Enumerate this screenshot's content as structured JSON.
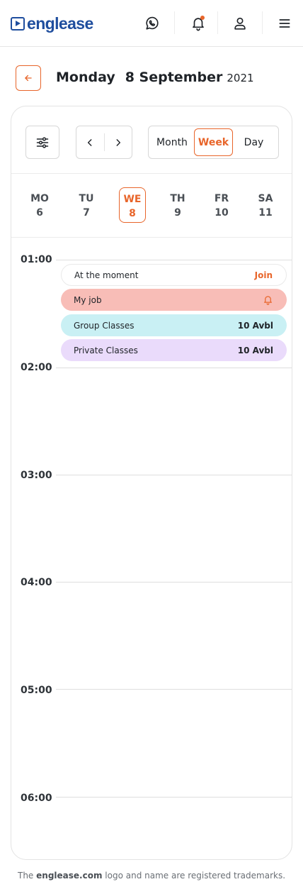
{
  "header": {
    "brand": "englease",
    "icons": {
      "whatsapp": "whatsapp-icon",
      "bell": "bell-icon",
      "user": "user-icon",
      "menu": "menu-icon"
    },
    "accent_color": "#e8652a",
    "brand_color": "#1f4e9e"
  },
  "date_bar": {
    "weekday": "Monday",
    "date": "8 September",
    "year": "2021"
  },
  "toolbar": {
    "views": [
      "Month",
      "Week",
      "Day"
    ],
    "active_view": "Week"
  },
  "week_days": [
    {
      "abbr": "MO",
      "num": "6"
    },
    {
      "abbr": "TU",
      "num": "7"
    },
    {
      "abbr": "WE",
      "num": "8",
      "active": true
    },
    {
      "abbr": "TH",
      "num": "9"
    },
    {
      "abbr": "FR",
      "num": "10"
    },
    {
      "abbr": "SA",
      "num": "11"
    }
  ],
  "hours": [
    "01:00",
    "02:00",
    "03:00",
    "04:00",
    "05:00",
    "06:00"
  ],
  "events": [
    {
      "title": "At the moment",
      "action": "Join"
    },
    {
      "title": "My job",
      "icon": "bell-icon"
    },
    {
      "title": "Group Classes",
      "count": "10 Avbl"
    },
    {
      "title": "Private Classes",
      "count": "10 Avbl"
    }
  ],
  "footer": {
    "prefix": "The",
    "brand": "englease.com",
    "suffix": "logo and name are registered trademarks."
  }
}
